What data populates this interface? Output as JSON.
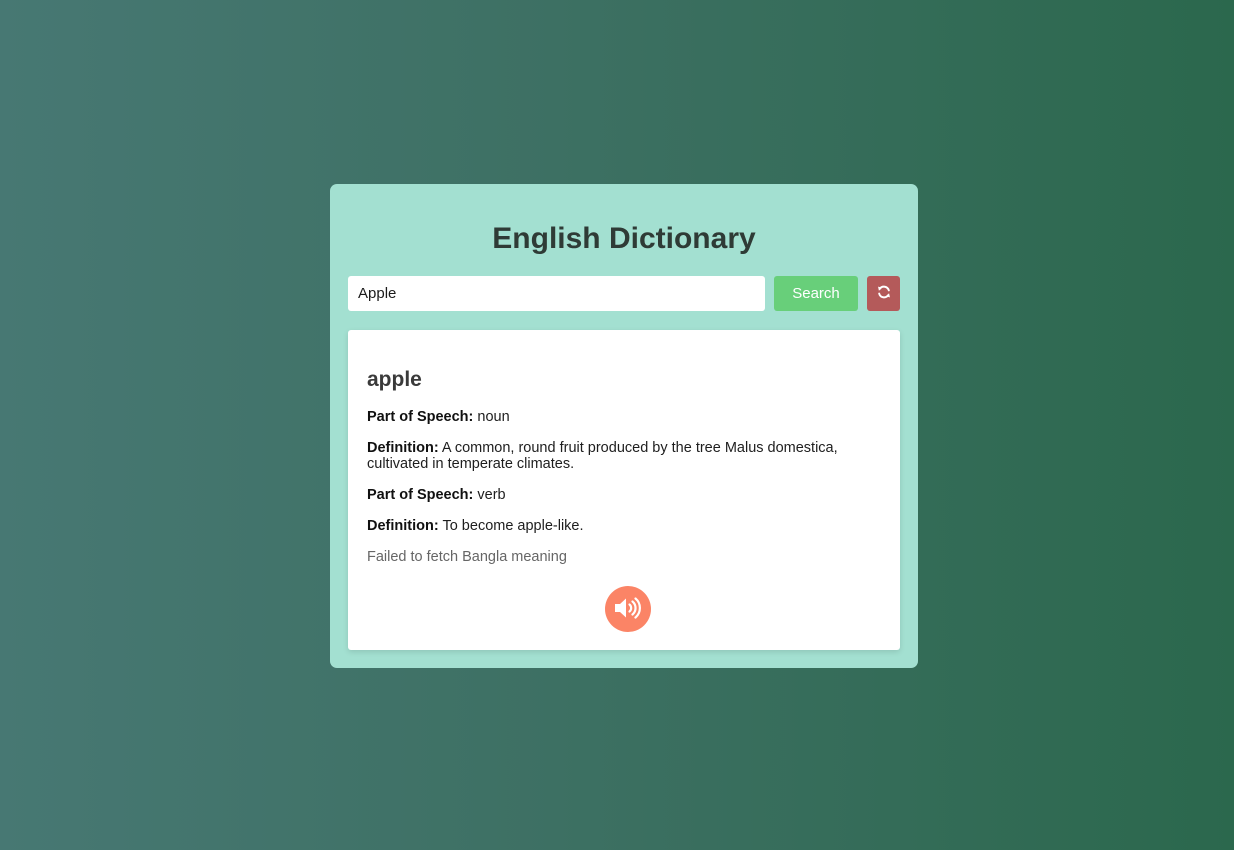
{
  "app": {
    "title": "English Dictionary"
  },
  "search": {
    "value": "Apple",
    "button_label": "Search",
    "refresh_icon": "refresh-icon"
  },
  "result": {
    "word": "apple",
    "meanings": [
      {
        "pos_label": "Part of Speech:",
        "pos": "noun",
        "def_label": "Definition:",
        "definition": "A common, round fruit produced by the tree Malus domestica, cultivated in temperate climates."
      },
      {
        "pos_label": "Part of Speech:",
        "pos": "verb",
        "def_label": "Definition:",
        "definition": "To become apple-like."
      }
    ],
    "bangla_status": "Failed to fetch Bangla meaning",
    "speak_icon": "volume-up-icon"
  },
  "colors": {
    "card_bg": "#a3e0d1",
    "search_button": "#68cf7a",
    "refresh_button": "#b45a5a",
    "speak_button": "#fb8466"
  }
}
